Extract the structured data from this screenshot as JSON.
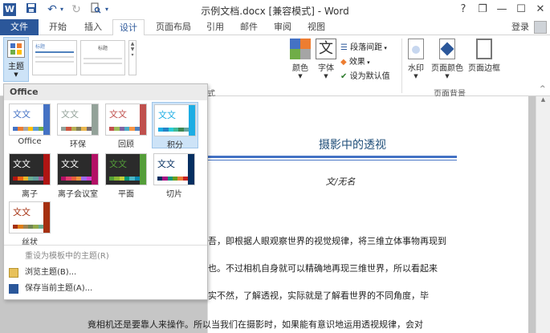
{
  "window": {
    "title": "示例文档.docx [兼容模式] - Word",
    "help": "?",
    "restore": "❐",
    "minimize": "—",
    "maximize": "☐",
    "close": "✕"
  },
  "quick": {
    "save_icon": "save-icon",
    "undo_icon": "undo-icon",
    "redo_icon": "redo-icon",
    "preview_icon": "print-preview-icon"
  },
  "tabs": [
    {
      "label": "文件"
    },
    {
      "label": "开始"
    },
    {
      "label": "插入"
    },
    {
      "label": "设计"
    },
    {
      "label": "页面布局"
    },
    {
      "label": "引用"
    },
    {
      "label": "邮件"
    },
    {
      "label": "审阅"
    },
    {
      "label": "视图"
    }
  ],
  "account": {
    "login": "登录"
  },
  "ribbon": {
    "theme_button": "主题",
    "gallery_title": "标题",
    "gallery_title2": "标题",
    "colors": "颜色",
    "fonts": "字体",
    "fonts_glyph": "文",
    "para_spacing": "段落间距",
    "effects": "效果",
    "set_default": "设为默认值",
    "watermark": "水印",
    "page_color": "页面颜色",
    "page_border": "页面边框",
    "group_page_bg": "页面背景",
    "group_doc_format": "式"
  },
  "dropdown": {
    "header": "Office",
    "themes": [
      {
        "name": "Office",
        "glyph": "文文",
        "colors": [
          "#4472c4",
          "#ed7d31",
          "#a5a5a5",
          "#ffc000",
          "#5b9bd5",
          "#70ad47"
        ]
      },
      {
        "name": "环保",
        "glyph": "文文",
        "colors": [
          "#93a299",
          "#cf543f",
          "#b5ae53",
          "#848058",
          "#e8b54d",
          "#786c71"
        ]
      },
      {
        "name": "回顾",
        "glyph": "文文",
        "colors": [
          "#c0504d",
          "#9bbb59",
          "#8064a2",
          "#4bacc6",
          "#f79646",
          "#4f81bd"
        ]
      },
      {
        "name": "积分",
        "glyph": "文文",
        "colors": [
          "#1cade4",
          "#2683c6",
          "#27ced7",
          "#42ba97",
          "#3e8853",
          "#62a39f"
        ]
      },
      {
        "name": "离子",
        "glyph": "文文",
        "colors": [
          "#b01513",
          "#ea6312",
          "#e6b729",
          "#6aac90",
          "#5f9c9d",
          "#9e5e9b"
        ]
      },
      {
        "name": "离子会议室",
        "glyph": "文文",
        "colors": [
          "#b31166",
          "#e33d6f",
          "#e45f3c",
          "#e9943a",
          "#9b6bf2",
          "#d53dd0"
        ]
      },
      {
        "name": "平面",
        "glyph": "文文",
        "colors": [
          "#549e39",
          "#8ab833",
          "#c0cf3a",
          "#029676",
          "#4ab5c4",
          "#0989b1"
        ]
      },
      {
        "name": "切片",
        "glyph": "文文",
        "colors": [
          "#052f61",
          "#a50e82",
          "#14967c",
          "#6a9e1f",
          "#e87d37",
          "#c62324"
        ]
      },
      {
        "name": "丝状",
        "glyph": "文文",
        "colors": [
          "#a53010",
          "#de7e18",
          "#9f8351",
          "#728653",
          "#92aa4c",
          "#6aac91"
        ]
      }
    ],
    "reset": "重设为模板中的主题(R)",
    "browse": "浏览主题(B)...",
    "save": "保存当前主题(A)..."
  },
  "document": {
    "title": "摄影中的透视",
    "author": "文/无名",
    "lines": [
      "吾，即根据人眼观察世界的视觉规律，将三维立体事物再现到",
      "也。不过相机自身就可以精确地再现三维世界，所以看起来",
      "实不然，了解透视，实际就是了解看世界的不同角度，毕",
      "竟相机还是要靠人来操作。所以当我们在摄影时，如果能有意识地运用透视规律，会对"
    ]
  }
}
